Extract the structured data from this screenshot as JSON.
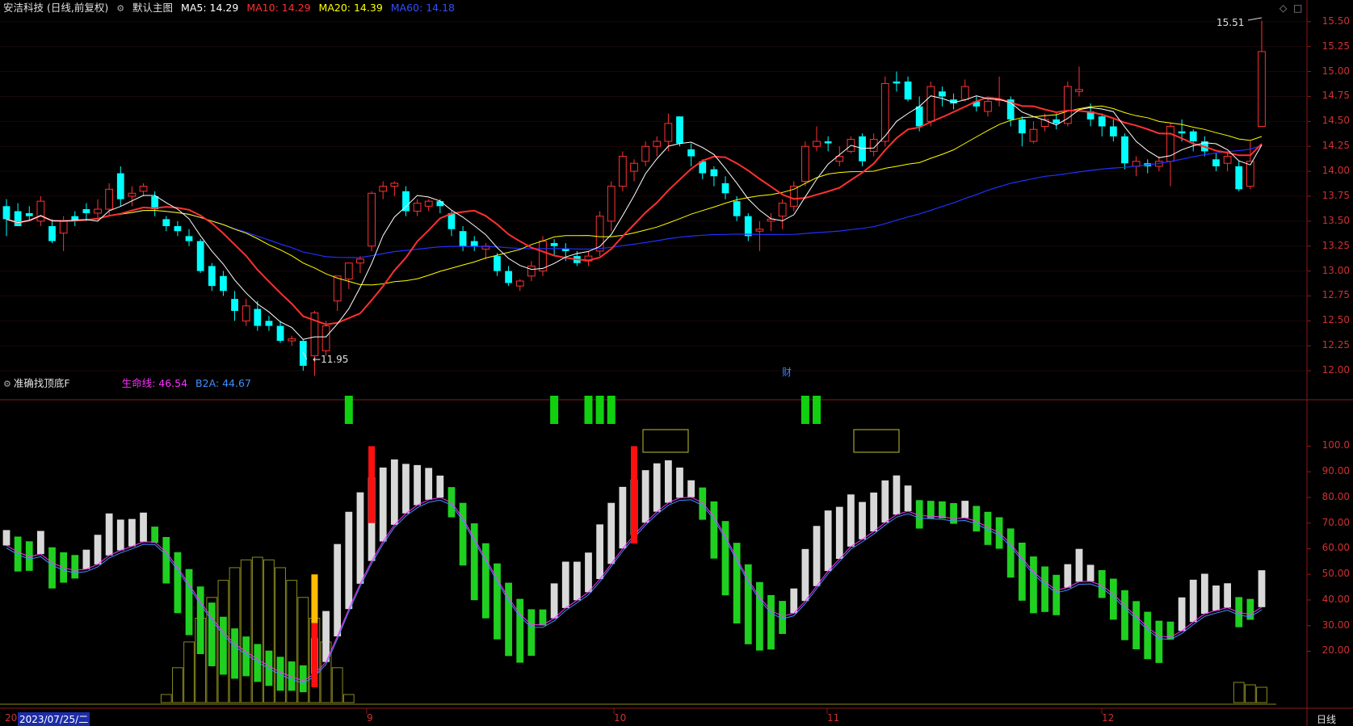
{
  "header": {
    "stock_title": "安洁科技 (日线,前复权)",
    "layout_name": "默认主图",
    "ma5": {
      "label": "MA5:",
      "value": "14.29",
      "color": "#ffffff"
    },
    "ma10": {
      "label": "MA10:",
      "value": "14.29",
      "color": "#ff3030"
    },
    "ma20": {
      "label": "MA20:",
      "value": "14.39",
      "color": "#ffff00"
    },
    "ma60": {
      "label": "MA60:",
      "value": "14.18",
      "color": "#3030ff"
    }
  },
  "indicator": {
    "name": "准确找顶底F",
    "life_line": {
      "label": "生命线:",
      "value": "46.54",
      "color": "#ff30ff"
    },
    "b2a": {
      "label": "B2A:",
      "value": "44.67",
      "color": "#4090ff"
    }
  },
  "price_axis": [
    "15.50",
    "15.25",
    "15.00",
    "14.75",
    "14.50",
    "14.25",
    "14.00",
    "13.75",
    "13.50",
    "13.25",
    "13.00",
    "12.75",
    "12.50",
    "12.25",
    "12.00"
  ],
  "indicator_axis": [
    "100.0",
    "90.00",
    "80.00",
    "70.00",
    "60.00",
    "50.00",
    "40.00",
    "30.00",
    "20.00"
  ],
  "annotations": {
    "high": "15.51",
    "low": "11.95",
    "finance_marker": "财"
  },
  "date_axis": {
    "cursor_date": "2023/07/25/二",
    "prefix": "20",
    "months": [
      "9",
      "10",
      "11",
      "12"
    ],
    "period": "日线"
  },
  "chart_data": {
    "type": "candlestick",
    "ylim": [
      11.75,
      15.62
    ],
    "candles": [
      [
        13.65,
        13.72,
        13.52,
        13.35
      ],
      [
        13.6,
        13.68,
        13.45,
        13.55
      ],
      [
        13.58,
        13.65,
        13.55,
        13.5
      ],
      [
        13.5,
        13.75,
        13.7,
        13.45
      ],
      [
        13.45,
        13.52,
        13.3,
        13.28
      ],
      [
        13.38,
        13.55,
        13.5,
        13.2
      ],
      [
        13.55,
        13.6,
        13.5,
        13.45
      ],
      [
        13.62,
        13.68,
        13.58,
        13.5
      ],
      [
        13.58,
        13.72,
        13.62,
        13.5
      ],
      [
        13.62,
        13.88,
        13.82,
        13.55
      ],
      [
        13.98,
        14.05,
        13.72,
        13.65
      ],
      [
        13.75,
        13.85,
        13.78,
        13.65
      ],
      [
        13.8,
        13.88,
        13.85,
        13.75
      ],
      [
        13.75,
        13.8,
        13.62,
        13.55
      ],
      [
        13.52,
        13.55,
        13.45,
        13.4
      ],
      [
        13.45,
        13.5,
        13.4,
        13.35
      ],
      [
        13.35,
        13.42,
        13.3,
        13.25
      ],
      [
        13.3,
        13.32,
        13.0,
        12.98
      ],
      [
        13.05,
        13.08,
        12.85,
        12.8
      ],
      [
        12.95,
        13.0,
        12.8,
        12.75
      ],
      [
        12.72,
        12.8,
        12.6,
        12.5
      ],
      [
        12.5,
        12.72,
        12.65,
        12.45
      ],
      [
        12.62,
        12.7,
        12.45,
        12.4
      ],
      [
        12.5,
        12.55,
        12.45,
        12.4
      ],
      [
        12.45,
        12.5,
        12.3,
        12.28
      ],
      [
        12.3,
        12.35,
        12.32,
        12.25
      ],
      [
        12.3,
        12.32,
        12.05,
        12.0
      ],
      [
        12.15,
        12.6,
        12.58,
        11.95
      ],
      [
        12.2,
        12.5,
        12.45,
        12.15
      ],
      [
        12.7,
        12.75,
        12.95,
        12.6
      ],
      [
        12.92,
        13.05,
        13.08,
        12.82
      ],
      [
        13.08,
        13.15,
        13.12,
        12.98
      ],
      [
        13.25,
        13.8,
        13.78,
        13.2
      ],
      [
        13.8,
        13.9,
        13.85,
        13.72
      ],
      [
        13.85,
        13.9,
        13.88,
        13.75
      ],
      [
        13.8,
        13.85,
        13.6,
        13.55
      ],
      [
        13.6,
        13.72,
        13.68,
        13.55
      ],
      [
        13.65,
        13.72,
        13.7,
        13.6
      ],
      [
        13.7,
        13.72,
        13.65,
        13.58
      ],
      [
        13.58,
        13.6,
        13.42,
        13.35
      ],
      [
        13.4,
        13.45,
        13.25,
        13.2
      ],
      [
        13.3,
        13.35,
        13.25,
        13.2
      ],
      [
        13.22,
        13.28,
        13.25,
        13.12
      ],
      [
        13.15,
        13.18,
        13.0,
        12.95
      ],
      [
        13.0,
        13.05,
        12.88,
        12.85
      ],
      [
        12.85,
        12.92,
        12.9,
        12.8
      ],
      [
        12.95,
        13.1,
        13.05,
        12.9
      ],
      [
        13.0,
        13.35,
        13.3,
        12.95
      ],
      [
        13.28,
        13.32,
        13.25,
        13.15
      ],
      [
        13.22,
        13.28,
        13.2,
        13.1
      ],
      [
        13.15,
        13.2,
        13.08,
        13.05
      ],
      [
        13.1,
        13.2,
        13.15,
        13.05
      ],
      [
        13.2,
        13.6,
        13.55,
        13.15
      ],
      [
        13.5,
        13.9,
        13.85,
        13.4
      ],
      [
        13.85,
        14.2,
        14.15,
        13.8
      ],
      [
        14.0,
        14.12,
        14.08,
        13.9
      ],
      [
        14.1,
        14.3,
        14.25,
        14.05
      ],
      [
        14.25,
        14.35,
        14.3,
        14.15
      ],
      [
        14.3,
        14.58,
        14.48,
        14.2
      ],
      [
        14.55,
        14.55,
        14.28,
        14.25
      ],
      [
        14.22,
        14.28,
        14.15,
        14.05
      ],
      [
        14.1,
        14.12,
        13.98,
        13.92
      ],
      [
        14.02,
        14.05,
        13.95,
        13.85
      ],
      [
        13.88,
        13.95,
        13.78,
        13.72
      ],
      [
        13.7,
        13.75,
        13.55,
        13.5
      ],
      [
        13.55,
        13.58,
        13.35,
        13.3
      ],
      [
        13.4,
        13.5,
        13.42,
        13.2
      ],
      [
        13.5,
        13.58,
        13.52,
        13.4
      ],
      [
        13.55,
        13.72,
        13.68,
        13.42
      ],
      [
        13.65,
        13.9,
        13.85,
        13.6
      ],
      [
        13.9,
        14.3,
        14.25,
        13.85
      ],
      [
        14.25,
        14.45,
        14.3,
        14.2
      ],
      [
        14.3,
        14.35,
        14.28,
        14.2
      ],
      [
        14.1,
        14.25,
        14.15,
        14.05
      ],
      [
        14.2,
        14.35,
        14.32,
        14.18
      ],
      [
        14.35,
        14.38,
        14.1,
        14.05
      ],
      [
        14.2,
        14.38,
        14.32,
        14.15
      ],
      [
        14.3,
        14.95,
        14.88,
        14.25
      ],
      [
        14.9,
        15.0,
        14.88,
        14.8
      ],
      [
        14.9,
        14.95,
        14.72,
        14.7
      ],
      [
        14.65,
        14.75,
        14.45,
        14.4
      ],
      [
        14.5,
        14.9,
        14.85,
        14.45
      ],
      [
        14.8,
        14.85,
        14.75,
        14.65
      ],
      [
        14.72,
        14.78,
        14.68,
        14.62
      ],
      [
        14.72,
        14.92,
        14.85,
        14.7
      ],
      [
        14.7,
        14.75,
        14.65,
        14.6
      ],
      [
        14.6,
        14.72,
        14.7,
        14.55
      ],
      [
        14.72,
        14.95,
        14.72,
        14.65
      ],
      [
        14.72,
        14.75,
        14.52,
        14.45
      ],
      [
        14.52,
        14.55,
        14.38,
        14.25
      ],
      [
        14.3,
        14.5,
        14.42,
        14.28
      ],
      [
        14.45,
        14.58,
        14.52,
        14.4
      ],
      [
        14.52,
        14.58,
        14.48,
        14.42
      ],
      [
        14.48,
        14.9,
        14.85,
        14.45
      ],
      [
        14.8,
        15.05,
        14.82,
        14.75
      ],
      [
        14.6,
        14.68,
        14.52,
        14.45
      ],
      [
        14.55,
        14.58,
        14.45,
        14.35
      ],
      [
        14.45,
        14.52,
        14.35,
        14.3
      ],
      [
        14.35,
        14.38,
        14.08,
        14.02
      ],
      [
        14.05,
        14.15,
        14.1,
        13.95
      ],
      [
        14.08,
        14.12,
        14.05,
        13.98
      ],
      [
        14.05,
        14.15,
        14.1,
        14.0
      ],
      [
        14.1,
        14.48,
        14.45,
        13.85
      ],
      [
        14.4,
        14.52,
        14.38,
        14.3
      ],
      [
        14.4,
        14.42,
        14.3,
        14.2
      ],
      [
        14.3,
        14.35,
        14.2,
        14.15
      ],
      [
        14.12,
        14.18,
        14.05,
        14.0
      ],
      [
        14.08,
        14.2,
        14.15,
        14.0
      ],
      [
        14.05,
        14.1,
        13.82,
        13.8
      ],
      [
        13.85,
        14.3,
        14.1,
        13.82
      ],
      [
        14.45,
        15.51,
        15.2,
        14.45
      ]
    ]
  }
}
